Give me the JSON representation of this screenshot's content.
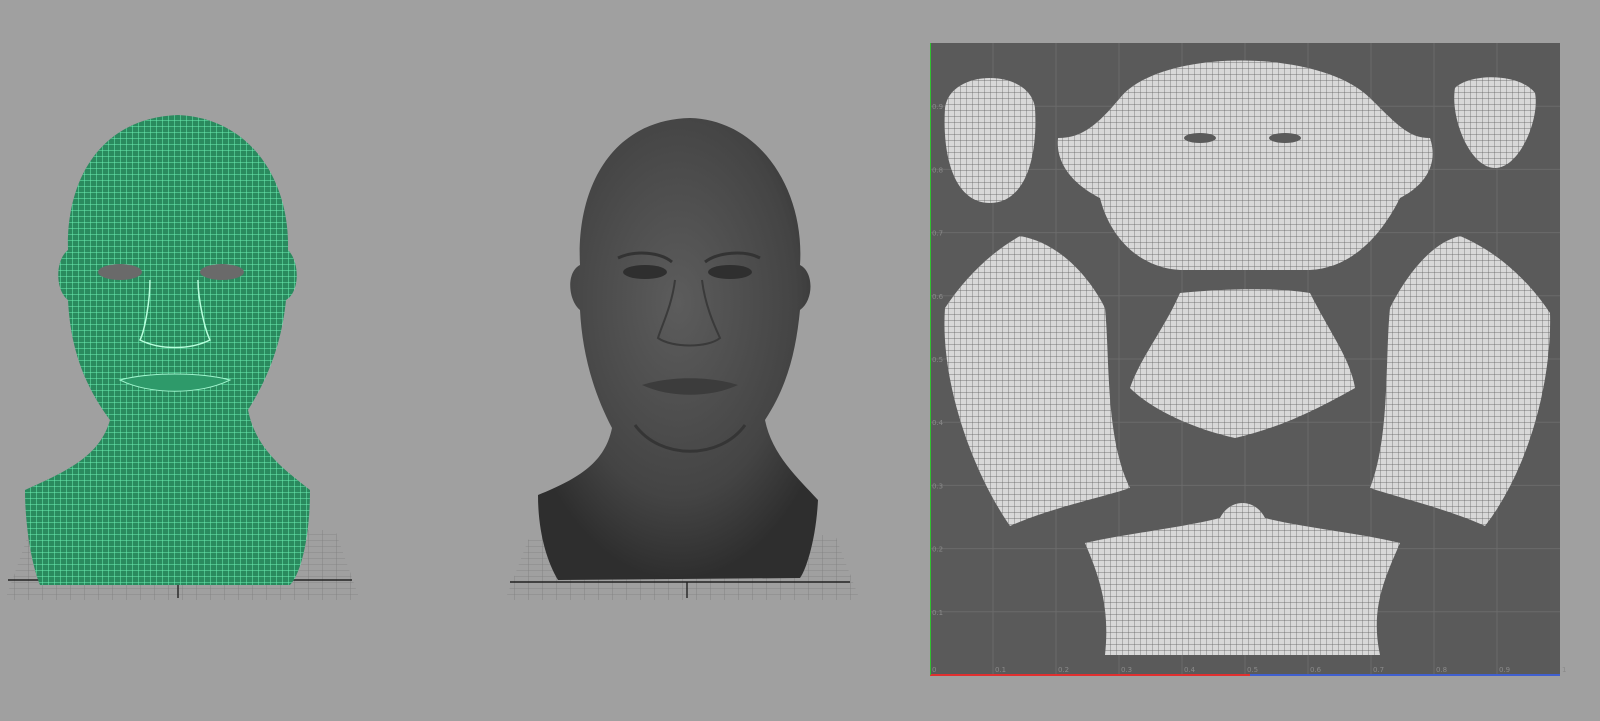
{
  "viewports": [
    {
      "name": "wireframe-perspective",
      "display": "wireframe",
      "wire_color": "#4fe0a0",
      "ground_grid": true
    },
    {
      "name": "smooth-shaded-perspective",
      "display": "smooth-shaded",
      "surface_color": "#4a4a4a",
      "ground_grid": true
    },
    {
      "name": "uv-texture-editor",
      "background": "#5a5a5a"
    }
  ],
  "uv_editor": {
    "u_ticks": [
      "0",
      "0.1",
      "0.2",
      "0.3",
      "0.4",
      "0.5",
      "0.6",
      "0.7",
      "0.8",
      "0.9",
      "1"
    ],
    "v_ticks": [
      "0.1",
      "0.2",
      "0.3",
      "0.4",
      "0.5",
      "0.6",
      "0.7",
      "0.8",
      "0.9"
    ],
    "u_axis_color": "#e03030",
    "v_axis_color": "#30c030",
    "shell_wire_color": "#ffffff"
  }
}
